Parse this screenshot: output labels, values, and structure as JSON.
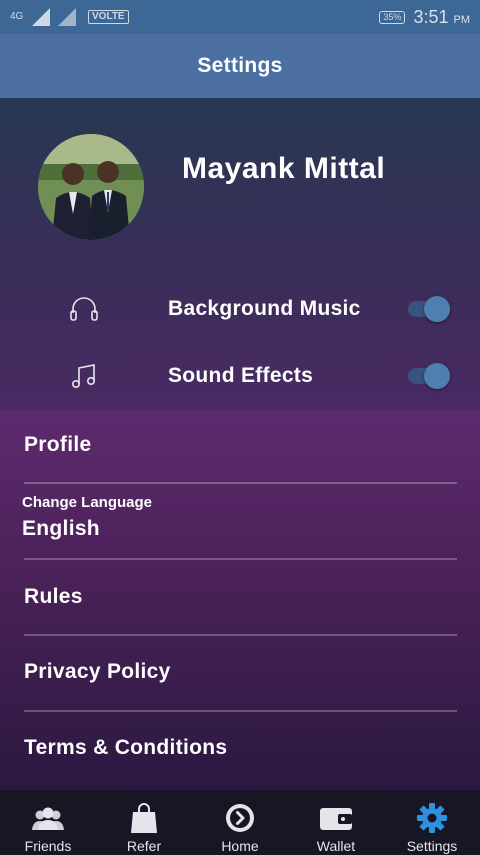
{
  "status_bar": {
    "network": "4G",
    "volte": "VOLTE",
    "battery": "35%",
    "time": "3:51",
    "ampm": "PM"
  },
  "page": {
    "title": "Settings"
  },
  "profile": {
    "name": "Mayank Mittal"
  },
  "toggles": [
    {
      "label": "Background Music",
      "icon": "headphones-icon",
      "on": true
    },
    {
      "label": "Sound Effects",
      "icon": "music-note-icon",
      "on": true
    }
  ],
  "settings": {
    "profile_label": "Profile",
    "language_label": "Change Language",
    "language_value": "English",
    "rules_label": "Rules",
    "privacy_label": "Privacy Policy",
    "terms_label": "Terms & Conditions"
  },
  "nav": {
    "items": [
      {
        "label": "Friends",
        "icon": "friends-icon"
      },
      {
        "label": "Refer",
        "icon": "shopping-bag-icon"
      },
      {
        "label": "Home",
        "icon": "home-play-icon"
      },
      {
        "label": "Wallet",
        "icon": "wallet-icon"
      },
      {
        "label": "Settings",
        "icon": "gear-icon",
        "active": true
      }
    ],
    "active_color": "#2f8fe0"
  }
}
